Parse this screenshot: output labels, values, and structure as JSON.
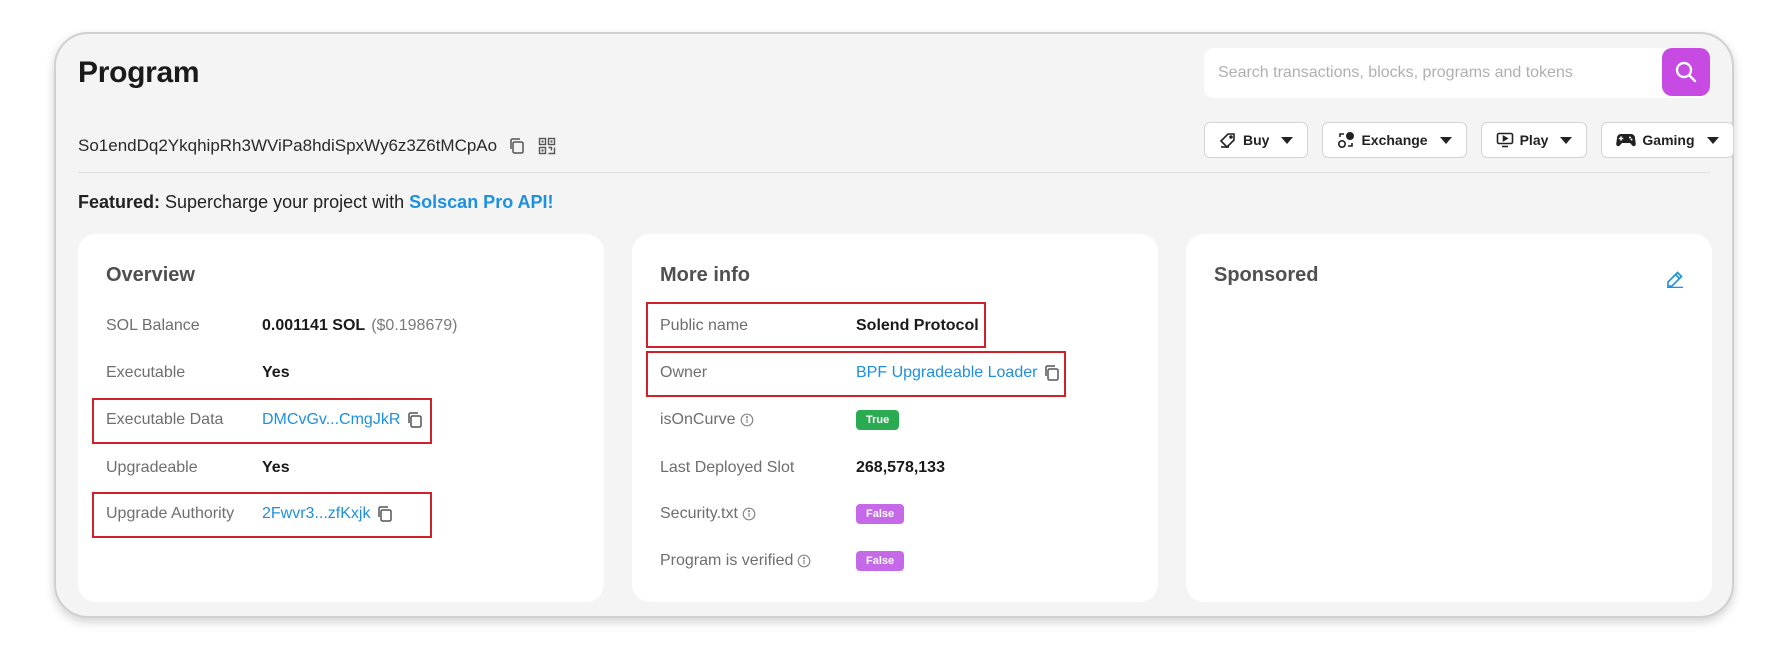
{
  "header": {
    "title": "Program",
    "search_placeholder": "Search transactions, blocks, programs and tokens"
  },
  "address": "So1endDq2YkqhipRh3WViPa8hdiSpxWy6z3Z6tMCpAo",
  "menus": [
    {
      "label": "Buy",
      "icon": "tag-icon"
    },
    {
      "label": "Exchange",
      "icon": "exchange-icon"
    },
    {
      "label": "Play",
      "icon": "monitor-play-icon"
    },
    {
      "label": "Gaming",
      "icon": "gamepad-icon"
    }
  ],
  "featured": {
    "prefix": "Featured:",
    "text": " Supercharge your project with ",
    "link": "Solscan Pro API!"
  },
  "overview": {
    "title": "Overview",
    "sol_balance": {
      "label": "SOL Balance",
      "value": "0.001141 SOL",
      "usd": "($0.198679)"
    },
    "executable": {
      "label": "Executable",
      "value": "Yes"
    },
    "executable_data": {
      "label": "Executable Data",
      "value": "DMCvGv...CmgJkR"
    },
    "upgradeable": {
      "label": "Upgradeable",
      "value": "Yes"
    },
    "upgrade_authority": {
      "label": "Upgrade Authority",
      "value": "2Fwvr3...zfKxjk"
    }
  },
  "more_info": {
    "title": "More info",
    "public_name": {
      "label": "Public name",
      "value": "Solend Protocol"
    },
    "owner": {
      "label": "Owner",
      "value": "BPF Upgradeable Loader"
    },
    "is_on_curve": {
      "label": "isOnCurve",
      "value": "True"
    },
    "last_deployed_slot": {
      "label": "Last Deployed Slot",
      "value": "268,578,133"
    },
    "security_txt": {
      "label": "Security.txt",
      "value": "False"
    },
    "program_verified": {
      "label": "Program is verified",
      "value": "False"
    }
  },
  "sponsored": {
    "title": "Sponsored"
  },
  "colors": {
    "accent": "#c74ae3",
    "link": "#1e90e0",
    "true_badge": "#2bab51",
    "false_badge": "#c569e8",
    "highlight": "#d0202a"
  }
}
